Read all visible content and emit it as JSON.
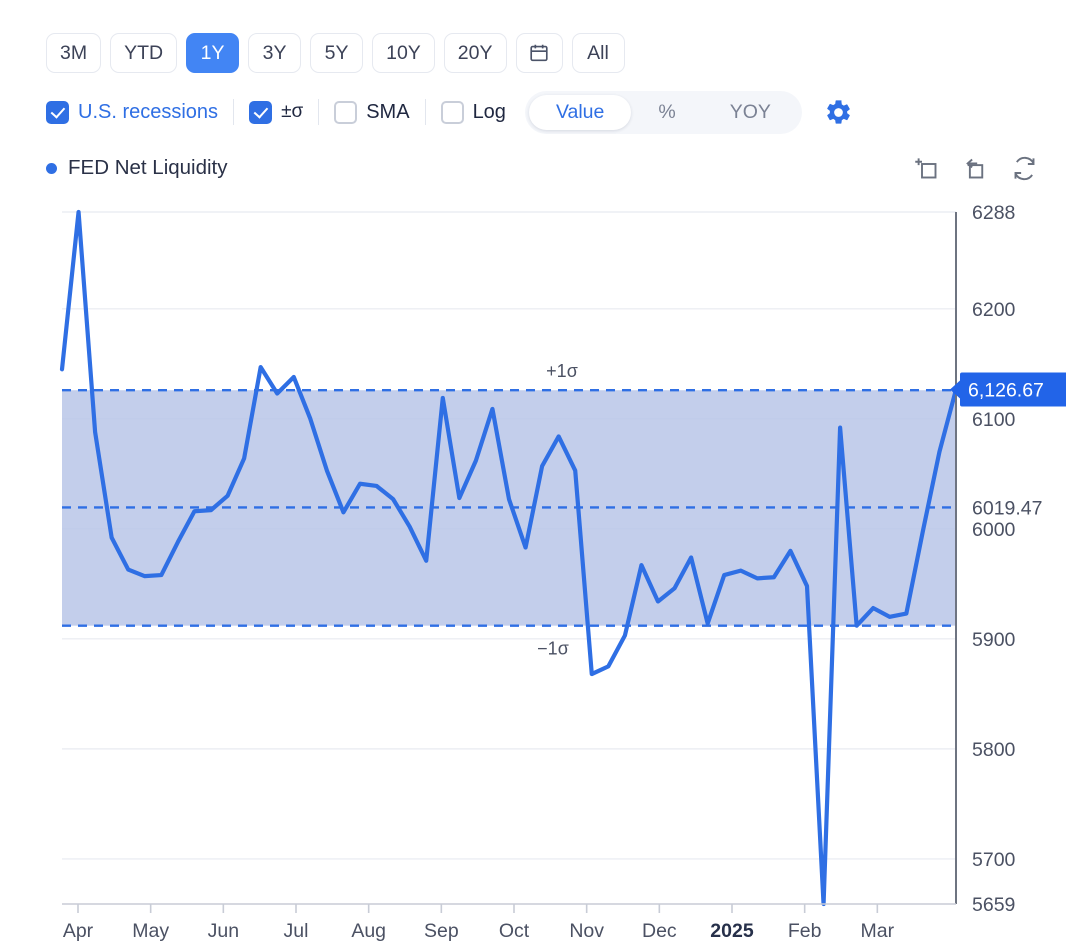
{
  "toolbar": {
    "ranges": [
      {
        "label": "3M",
        "active": false,
        "icon": null
      },
      {
        "label": "YTD",
        "active": false,
        "icon": null
      },
      {
        "label": "1Y",
        "active": true,
        "icon": null
      },
      {
        "label": "3Y",
        "active": false,
        "icon": null
      },
      {
        "label": "5Y",
        "active": false,
        "icon": null
      },
      {
        "label": "10Y",
        "active": false,
        "icon": null
      },
      {
        "label": "20Y",
        "active": false,
        "icon": null
      },
      {
        "label": "",
        "active": false,
        "icon": "calendar-icon"
      },
      {
        "label": "All",
        "active": false,
        "icon": null
      }
    ],
    "options": [
      {
        "label": "U.S. recessions",
        "checked": true,
        "accent": true
      },
      {
        "label": "±σ",
        "checked": true,
        "accent": false
      },
      {
        "label": "SMA",
        "checked": false,
        "accent": false
      },
      {
        "label": "Log",
        "checked": false,
        "accent": false
      }
    ],
    "modes": [
      {
        "label": "Value",
        "active": true
      },
      {
        "label": "%",
        "active": false
      },
      {
        "label": "YOY",
        "active": false
      }
    ],
    "settings_icon": "gear-icon"
  },
  "legend": {
    "series_name": "FED Net Liquidity",
    "series_color": "#2f6fe4",
    "tools": [
      "add-crop-icon",
      "undo-icon",
      "refresh-icon"
    ]
  },
  "chart_data": {
    "type": "line",
    "title": "FED Net Liquidity",
    "xlabel": "",
    "ylabel": "",
    "ylim": [
      5659,
      6288
    ],
    "grid": true,
    "legend_position": "top-left",
    "y_ticks": [
      6288,
      6200,
      6100,
      6000,
      5900,
      5800,
      5700,
      5659
    ],
    "x_ticks": [
      "Apr",
      "May",
      "Jun",
      "Jul",
      "Aug",
      "Sep",
      "Oct",
      "Nov",
      "Dec",
      "2025",
      "Feb",
      "Mar"
    ],
    "x_tick_bold": "2025",
    "bands": {
      "mean": 6019.47,
      "mean_label": "6019.47",
      "upper_sigma": 6126.0,
      "lower_sigma": 5912.0,
      "upper_label": "+1σ",
      "lower_label": "−1σ",
      "fill_color": "#b9c6e8",
      "line_color": "#2f6fe4"
    },
    "last_value": 6126.67,
    "last_value_label": "6,126.67",
    "series": [
      {
        "name": "FED Net Liquidity",
        "color": "#2f6fe4",
        "values": [
          6145,
          6288,
          6088,
          5992,
          5963,
          5957,
          5958,
          5988,
          6016,
          6017,
          6030,
          6064,
          6147,
          6123,
          6138,
          6100,
          6053,
          6015,
          6041,
          6039,
          6027,
          6002,
          5971,
          6119,
          6028,
          6062,
          6109,
          6027,
          5983,
          6057,
          6084,
          6053,
          5868,
          5875,
          5903,
          5967,
          5934,
          5946,
          5974,
          5914,
          5958,
          5962,
          5955,
          5956,
          5980,
          5948,
          5659,
          6092,
          5912,
          5928,
          5920,
          5923,
          5998,
          6070,
          6126.67
        ]
      }
    ]
  }
}
